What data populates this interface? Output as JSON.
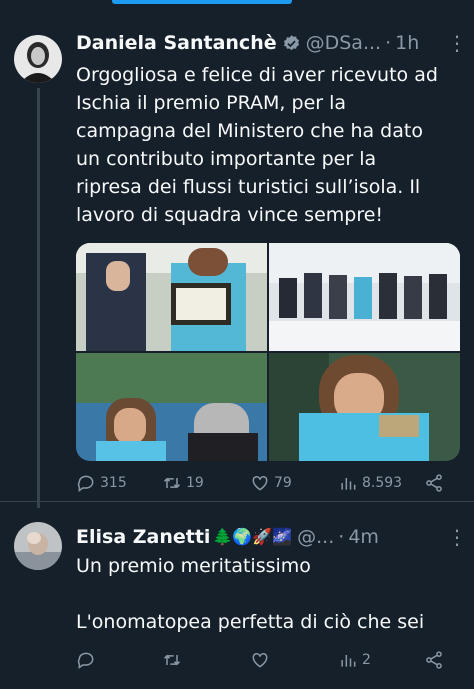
{
  "tweet1": {
    "author_name": "Daniela Santanchè",
    "handle": "@DSa...",
    "separator": "·",
    "time": "1h",
    "more_label": "⋮",
    "text": "Orgogliosa e felice di aver ricevuto ad\nIschia il premio PRAM, per la\ncampagna del Ministero che ha dato\nun contributo importante per la\nripresa dei flussi turistici sull’isola. Il\nlavoro di squadra vince sempre!",
    "actions": {
      "replies": "315",
      "retweets": "19",
      "likes": "79",
      "views": "8.593"
    }
  },
  "tweet2": {
    "author_name": "Elisa Zanetti",
    "emojis": "🌲🌍🚀🌌",
    "handle": "@...",
    "separator": "·",
    "time": "4m",
    "more_label": "⋮",
    "text": "Un premio meritatissimo\n\nL'onomatopea perfetta di ciò che sei",
    "actions": {
      "replies": "",
      "retweets": "",
      "likes": "",
      "views": "2"
    }
  },
  "icons": {
    "verified": "verified-badge-icon",
    "reply": "reply-icon",
    "retweet": "retweet-icon",
    "like": "heart-icon",
    "views": "views-chart-icon",
    "share": "share-icon"
  },
  "colors": {
    "background": "#15202b",
    "accent": "#1d9bf0",
    "muted": "#8b98a5",
    "text": "#f7f9f9"
  }
}
